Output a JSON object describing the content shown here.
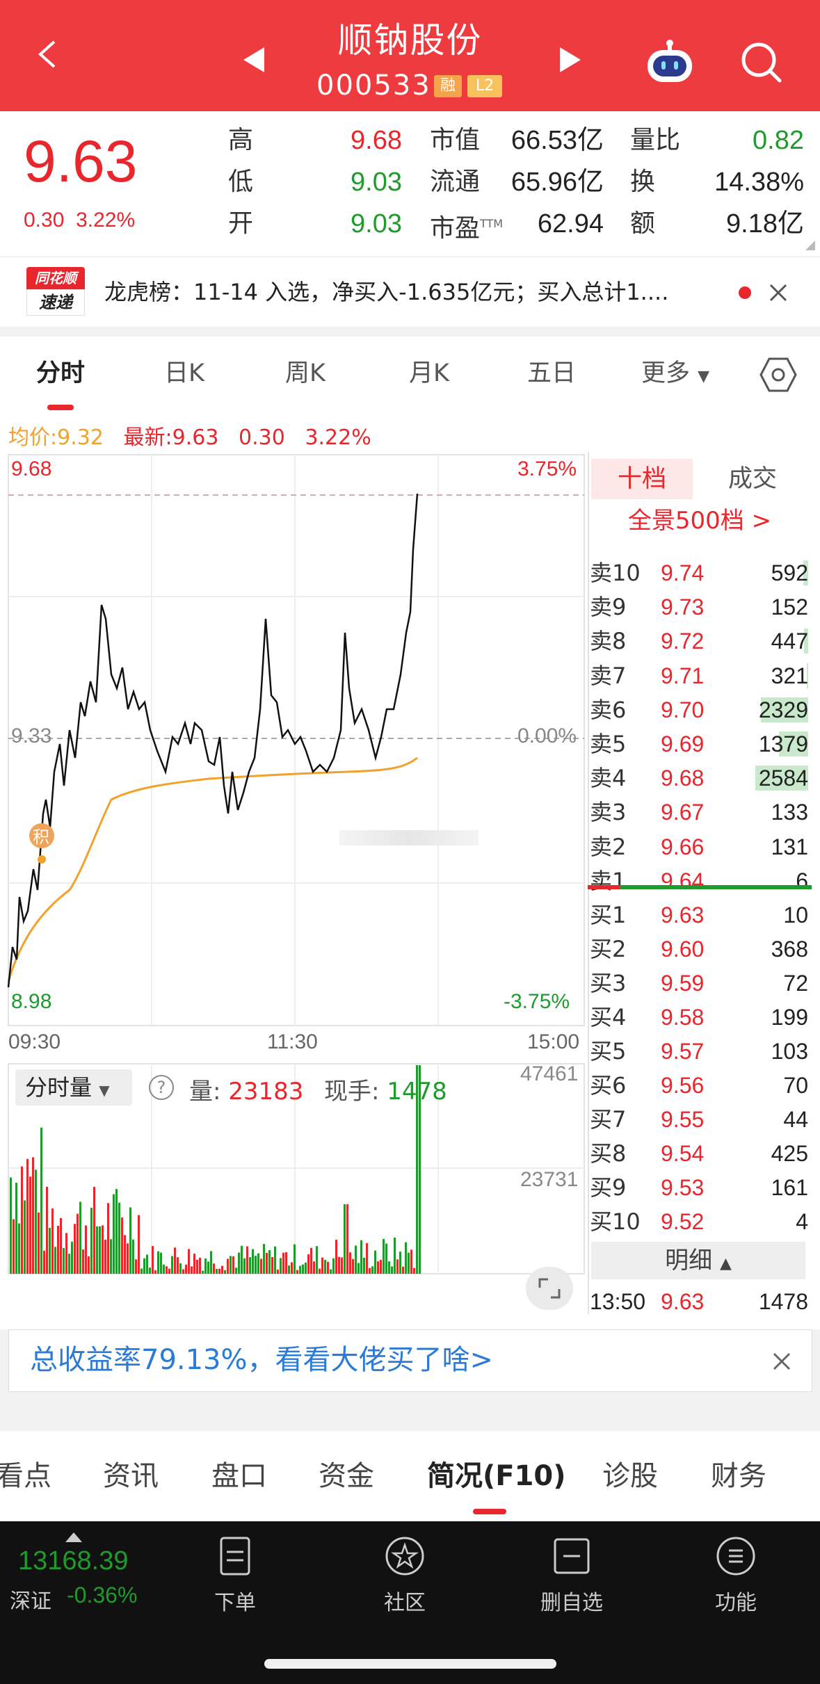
{
  "header": {
    "title": "顺钠股份",
    "code": "000533",
    "badge_rong": "融",
    "badge_l2": "L2"
  },
  "quote": {
    "price": "9.63",
    "change": "0.30",
    "change_pct": "3.22%",
    "high_label": "高",
    "high": "9.68",
    "low_label": "低",
    "low": "9.03",
    "open_label": "开",
    "open": "9.03",
    "mktcap_label": "市值",
    "mktcap": "66.53亿",
    "float_label": "流通",
    "float": "65.96亿",
    "pe_label": "市盈",
    "pe_sup": "TTM",
    "pe": "62.94",
    "volratio_label": "量比",
    "volratio": "0.82",
    "turnover_label": "换",
    "turnover": "14.38%",
    "amount_label": "额",
    "amount": "9.18亿"
  },
  "news": {
    "logo_line1": "同花顺",
    "logo_line2": "速递",
    "text": "龙虎榜：11-14 入选，净买入-1.635亿元；买入总计1...."
  },
  "tabs": [
    "分时",
    "日K",
    "周K",
    "月K",
    "五日",
    "更多"
  ],
  "chart": {
    "avg_label": "均价:",
    "avg_value": "9.32",
    "latest_label": "最新:",
    "latest_value": "9.63",
    "latest_change": "0.30",
    "latest_pct": "3.22%",
    "y_top": "9.68",
    "y_mid": "9.33",
    "y_bot": "8.98",
    "pct_top": "3.75%",
    "pct_mid": "0.00%",
    "pct_bot": "-3.75%",
    "x_labels": [
      "09:30",
      "11:30",
      "15:00"
    ],
    "marker": "积",
    "vol_selector": "分时量",
    "help_icon": "?",
    "vol_label": "量:",
    "vol_value": "23183",
    "hand_label": "现手:",
    "hand_value": "1478",
    "vol_top": "47461",
    "vol_mid": "23731"
  },
  "chart_data": {
    "type": "line",
    "title": "",
    "ylim": [
      8.98,
      9.68
    ],
    "x": [
      "09:30",
      "11:30",
      "15:00"
    ],
    "series": [
      {
        "name": "",
        "values": [
          8.98,
          9.21,
          9.16,
          9.34,
          9.48,
          9.38,
          9.36,
          9.5,
          9.33,
          9.28,
          9.36,
          9.31,
          9.27,
          9.48,
          9.36,
          9.32,
          9.3,
          9.31,
          9.45,
          9.34,
          9.34,
          9.38,
          9.45,
          9.63
        ]
      },
      {
        "name": "均价",
        "values": [
          8.99,
          9.12,
          9.22,
          9.27,
          9.28,
          9.29,
          9.29,
          9.3,
          9.3,
          9.3,
          9.3,
          9.31,
          9.31,
          9.31,
          9.31,
          9.32
        ]
      }
    ],
    "volume": {
      "ylim": [
        0,
        47461
      ],
      "last": 23183
    }
  },
  "orderbook": {
    "tab_active": "十档",
    "tab_other": "成交",
    "panorama": "全景500档 >",
    "asks": [
      {
        "name": "卖10",
        "price": "9.74",
        "vol": "592",
        "bar": 0.06
      },
      {
        "name": "卖9",
        "price": "9.73",
        "vol": "152",
        "bar": 0.0
      },
      {
        "name": "卖8",
        "price": "9.72",
        "vol": "447",
        "bar": 0.05
      },
      {
        "name": "卖7",
        "price": "9.71",
        "vol": "321",
        "bar": 0.02
      },
      {
        "name": "卖6",
        "price": "9.70",
        "vol": "2329",
        "bar": 0.62
      },
      {
        "name": "卖5",
        "price": "9.69",
        "vol": "1379",
        "bar": 0.38
      },
      {
        "name": "卖4",
        "price": "9.68",
        "vol": "2584",
        "bar": 0.69
      },
      {
        "name": "卖3",
        "price": "9.67",
        "vol": "133",
        "bar": 0.0
      },
      {
        "name": "卖2",
        "price": "9.66",
        "vol": "131",
        "bar": 0.0
      },
      {
        "name": "卖1",
        "price": "9.64",
        "vol": "6",
        "bar": 0.0
      }
    ],
    "bids": [
      {
        "name": "买1",
        "price": "9.63",
        "vol": "10"
      },
      {
        "name": "买2",
        "price": "9.60",
        "vol": "368"
      },
      {
        "name": "买3",
        "price": "9.59",
        "vol": "72"
      },
      {
        "name": "买4",
        "price": "9.58",
        "vol": "199"
      },
      {
        "name": "买5",
        "price": "9.57",
        "vol": "103"
      },
      {
        "name": "买6",
        "price": "9.56",
        "vol": "70"
      },
      {
        "name": "买7",
        "price": "9.55",
        "vol": "44"
      },
      {
        "name": "买8",
        "price": "9.54",
        "vol": "425"
      },
      {
        "name": "买9",
        "price": "9.53",
        "vol": "161"
      },
      {
        "name": "买10",
        "price": "9.52",
        "vol": "4"
      }
    ],
    "detail_label": "明细",
    "detail_time": "13:50",
    "detail_price": "9.63",
    "detail_vol": "1478"
  },
  "ad": {
    "text": "总收益率79.13%，看看大佬买了啥>"
  },
  "bottom_tabs": [
    "看点",
    "资讯",
    "盘口",
    "资金",
    "简况(F10)",
    "诊股",
    "财务"
  ],
  "footer": {
    "index_value": "13168.39",
    "index_name": "深证",
    "index_pct": "-0.36%",
    "items": [
      "下单",
      "社区",
      "删自选",
      "功能"
    ]
  },
  "colors": {
    "brand_red": "#ee3b3f",
    "up_red": "#e8262c",
    "down_green": "#1e9b2c",
    "avg_orange": "#f2a12b"
  }
}
